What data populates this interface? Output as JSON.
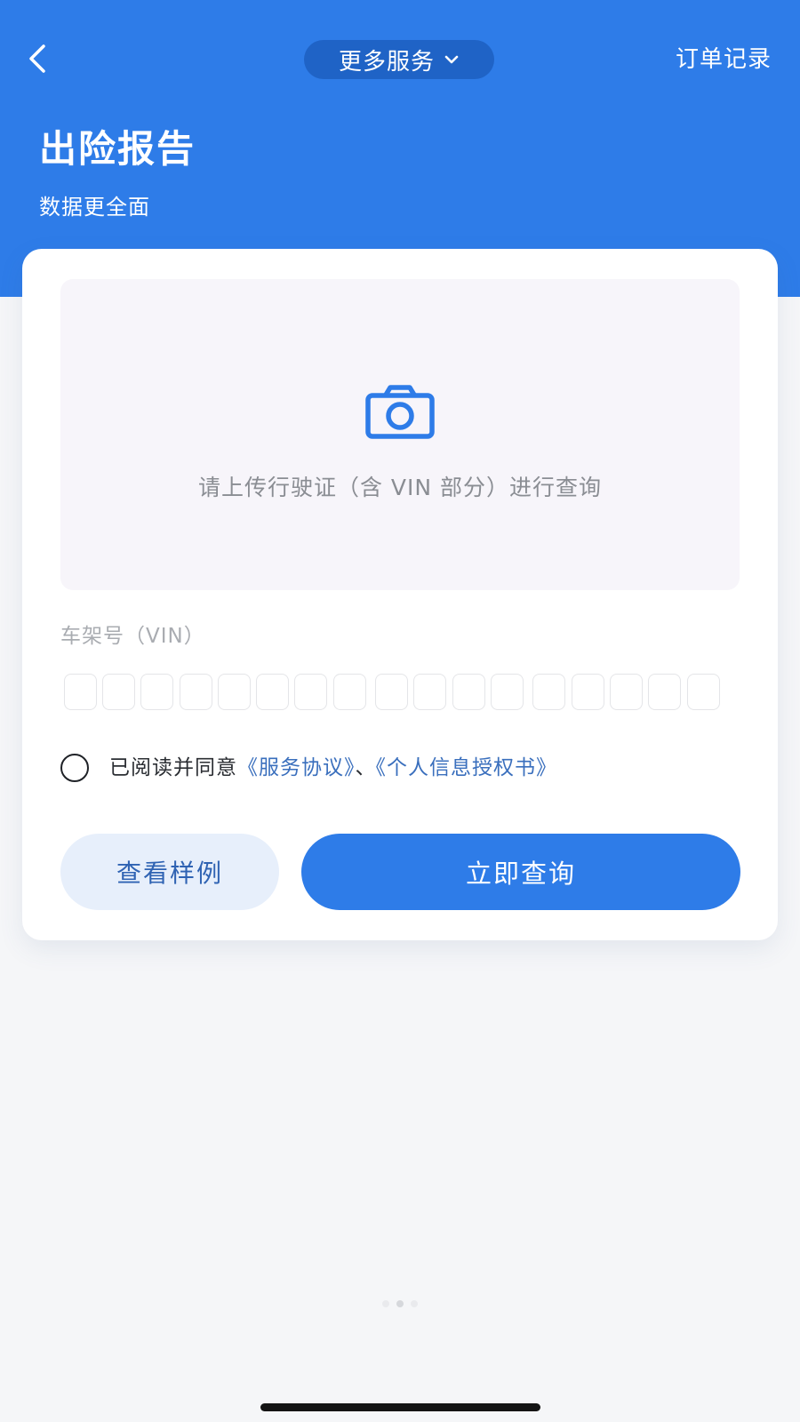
{
  "nav": {
    "back_icon": "chevron-left-icon",
    "service_label": "更多服务",
    "service_dropdown_icon": "chevron-down-icon",
    "orders_label": "订单记录"
  },
  "header": {
    "title": "出险报告",
    "subtitle": "数据更全面"
  },
  "upload": {
    "icon": "camera-icon",
    "hint": "请上传行驶证（含 VIN 部分）进行查询"
  },
  "vin": {
    "label": "车架号（VIN）",
    "box_count": 17
  },
  "agreement": {
    "checked": false,
    "prefix": "已阅读并同意",
    "link_terms": "《服务协议》",
    "separator": "、",
    "link_auth": "《个人信息授权书》"
  },
  "actions": {
    "sample_label": "查看样例",
    "query_label": "立即查询"
  },
  "pager": {
    "count": 3,
    "active": 1
  },
  "colors": {
    "primary": "#2e7ce8",
    "pill": "#1f63c6",
    "link": "#3a6fbd",
    "secondary_button": "#e7effb",
    "upload_bg": "#f7f5fa",
    "page_bg": "#f5f6f8"
  }
}
